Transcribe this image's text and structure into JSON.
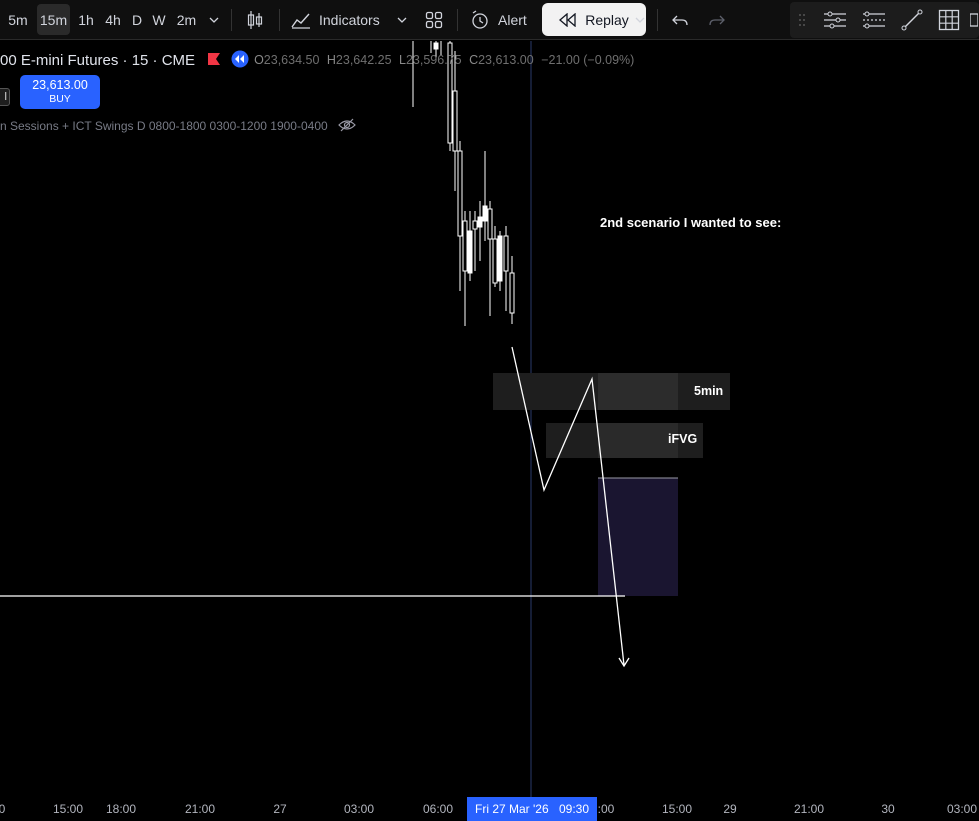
{
  "toolbar": {
    "intervals": [
      "5m",
      "15m",
      "1h",
      "4h",
      "D",
      "W",
      "2m"
    ],
    "active_interval": "15m",
    "indicators_label": "Indicators",
    "alert_label": "Alert",
    "replay_label": "Replay"
  },
  "legend": {
    "symbol_title": "00 E-mini Futures · 15 · CME",
    "open_key": "O",
    "open_value": "23,634.50",
    "high_key": "H",
    "high_value": "23,642.25",
    "low_key": "L",
    "low_value": "23,596.75",
    "close_key": "C",
    "close_value": "23,613.00",
    "change": "−21.00 (−0.09%)"
  },
  "trade": {
    "buy_price": "23,613.00",
    "buy_label": "BUY",
    "sell_stub": "l"
  },
  "indicator": {
    "label": "n Sessions + ICT Swings D 0800-1800 0300-1200 1900-0400"
  },
  "drawings": {
    "annotation_text": "2nd scenario I wanted to see:",
    "zone_5min_label": "5min",
    "zone_ifvg_label": "iFVG"
  },
  "time_axis": {
    "labels": [
      "0",
      "15:00",
      "18:00",
      "21:00",
      "27",
      "03:00",
      "06:00",
      ":00",
      "15:00",
      "29",
      "21:00",
      "30",
      "03:00"
    ],
    "cursor_date": "Fri 27 Mar '26",
    "cursor_time": "09:30"
  },
  "colors": {
    "background": "#000000",
    "accent": "#2962ff",
    "candle": "#ffffff"
  }
}
